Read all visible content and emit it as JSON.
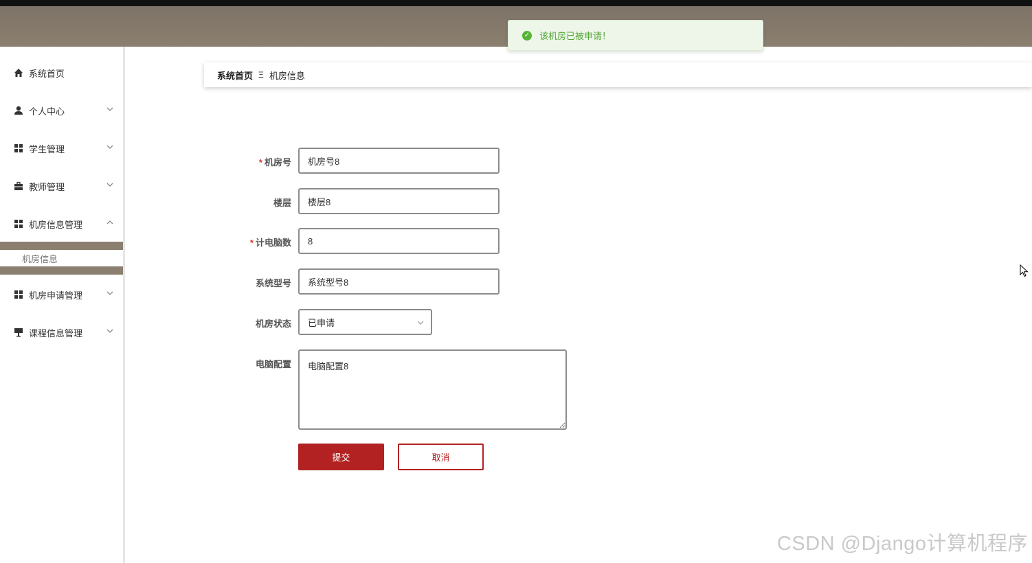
{
  "toast": {
    "text": "该机房已被申请！",
    "icon": "check-circle-icon",
    "color": "#54b435"
  },
  "sidebar": {
    "items": [
      {
        "label": "系统首页",
        "icon": "home-icon",
        "has_chevron": false
      },
      {
        "label": "个人中心",
        "icon": "user-icon",
        "has_chevron": true
      },
      {
        "label": "学生管理",
        "icon": "grid-icon",
        "has_chevron": true
      },
      {
        "label": "教师管理",
        "icon": "briefcase-icon",
        "has_chevron": true
      },
      {
        "label": "机房信息管理",
        "icon": "grid-icon",
        "has_chevron": true,
        "expanded": true
      },
      {
        "label": "机房申请管理",
        "icon": "grid-icon",
        "has_chevron": true
      },
      {
        "label": "课程信息管理",
        "icon": "presentation-icon",
        "has_chevron": true
      }
    ],
    "submenu": {
      "label": "机房信息"
    }
  },
  "breadcrumb": {
    "home": "系统首页",
    "separator": "Ξ",
    "current": "机房信息"
  },
  "form": {
    "room_number": {
      "label": "机房号",
      "required": true,
      "value": "机房号8"
    },
    "floor": {
      "label": "楼层",
      "required": false,
      "value": "楼层8"
    },
    "computer_count": {
      "label": "计电脑数",
      "required": true,
      "value": "8"
    },
    "system_model": {
      "label": "系统型号",
      "required": false,
      "value": "系统型号8"
    },
    "room_status": {
      "label": "机房状态",
      "required": false,
      "value": "已申请"
    },
    "computer_config": {
      "label": "电脑配置",
      "required": false,
      "value": "电脑配置8"
    }
  },
  "buttons": {
    "submit": "提交",
    "cancel": "取消"
  },
  "watermark": "CSDN @Django计算机程序",
  "colors": {
    "accent": "#b22222",
    "header": "#8b7f70",
    "success": "#54b435"
  }
}
